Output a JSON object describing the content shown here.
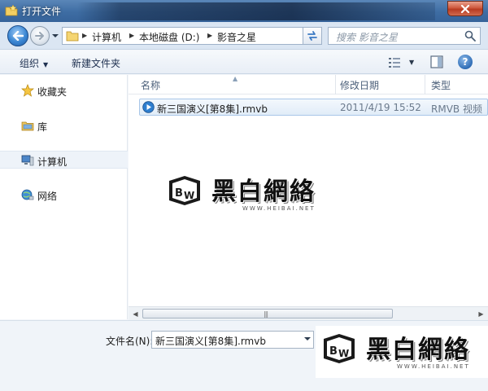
{
  "window": {
    "title": "打开文件"
  },
  "address": {
    "crumbs": [
      "计算机",
      "本地磁盘 (D:)",
      "影音之星"
    ],
    "search_placeholder": "搜索 影音之星"
  },
  "toolbar": {
    "organize_label": "组织",
    "new_folder_label": "新建文件夹"
  },
  "nav": {
    "items": [
      {
        "label": "收藏夹",
        "icon": "star-icon"
      },
      {
        "label": "库",
        "icon": "library-icon"
      },
      {
        "label": "计算机",
        "icon": "computer-icon",
        "selected": true
      },
      {
        "label": "网络",
        "icon": "network-icon"
      }
    ]
  },
  "files": {
    "columns": [
      "名称",
      "修改日期",
      "类型"
    ],
    "rows": [
      {
        "name": "新三国演义[第8集].rmvb",
        "modified": "2011/4/19 15:52",
        "type": "RMVB 视频",
        "icon": "video-file-icon",
        "selected": true
      }
    ]
  },
  "bottom": {
    "filename_label": "文件名(N):",
    "filename_value": "新三国演义[第8集].rmvb"
  },
  "watermark": {
    "brand": "黑白網絡",
    "url": "WWW.HEIBAI.NET"
  },
  "colors": {
    "titlebar": "#3e6da3",
    "accent": "#2f6db6",
    "selection": "#e1ecf8"
  }
}
